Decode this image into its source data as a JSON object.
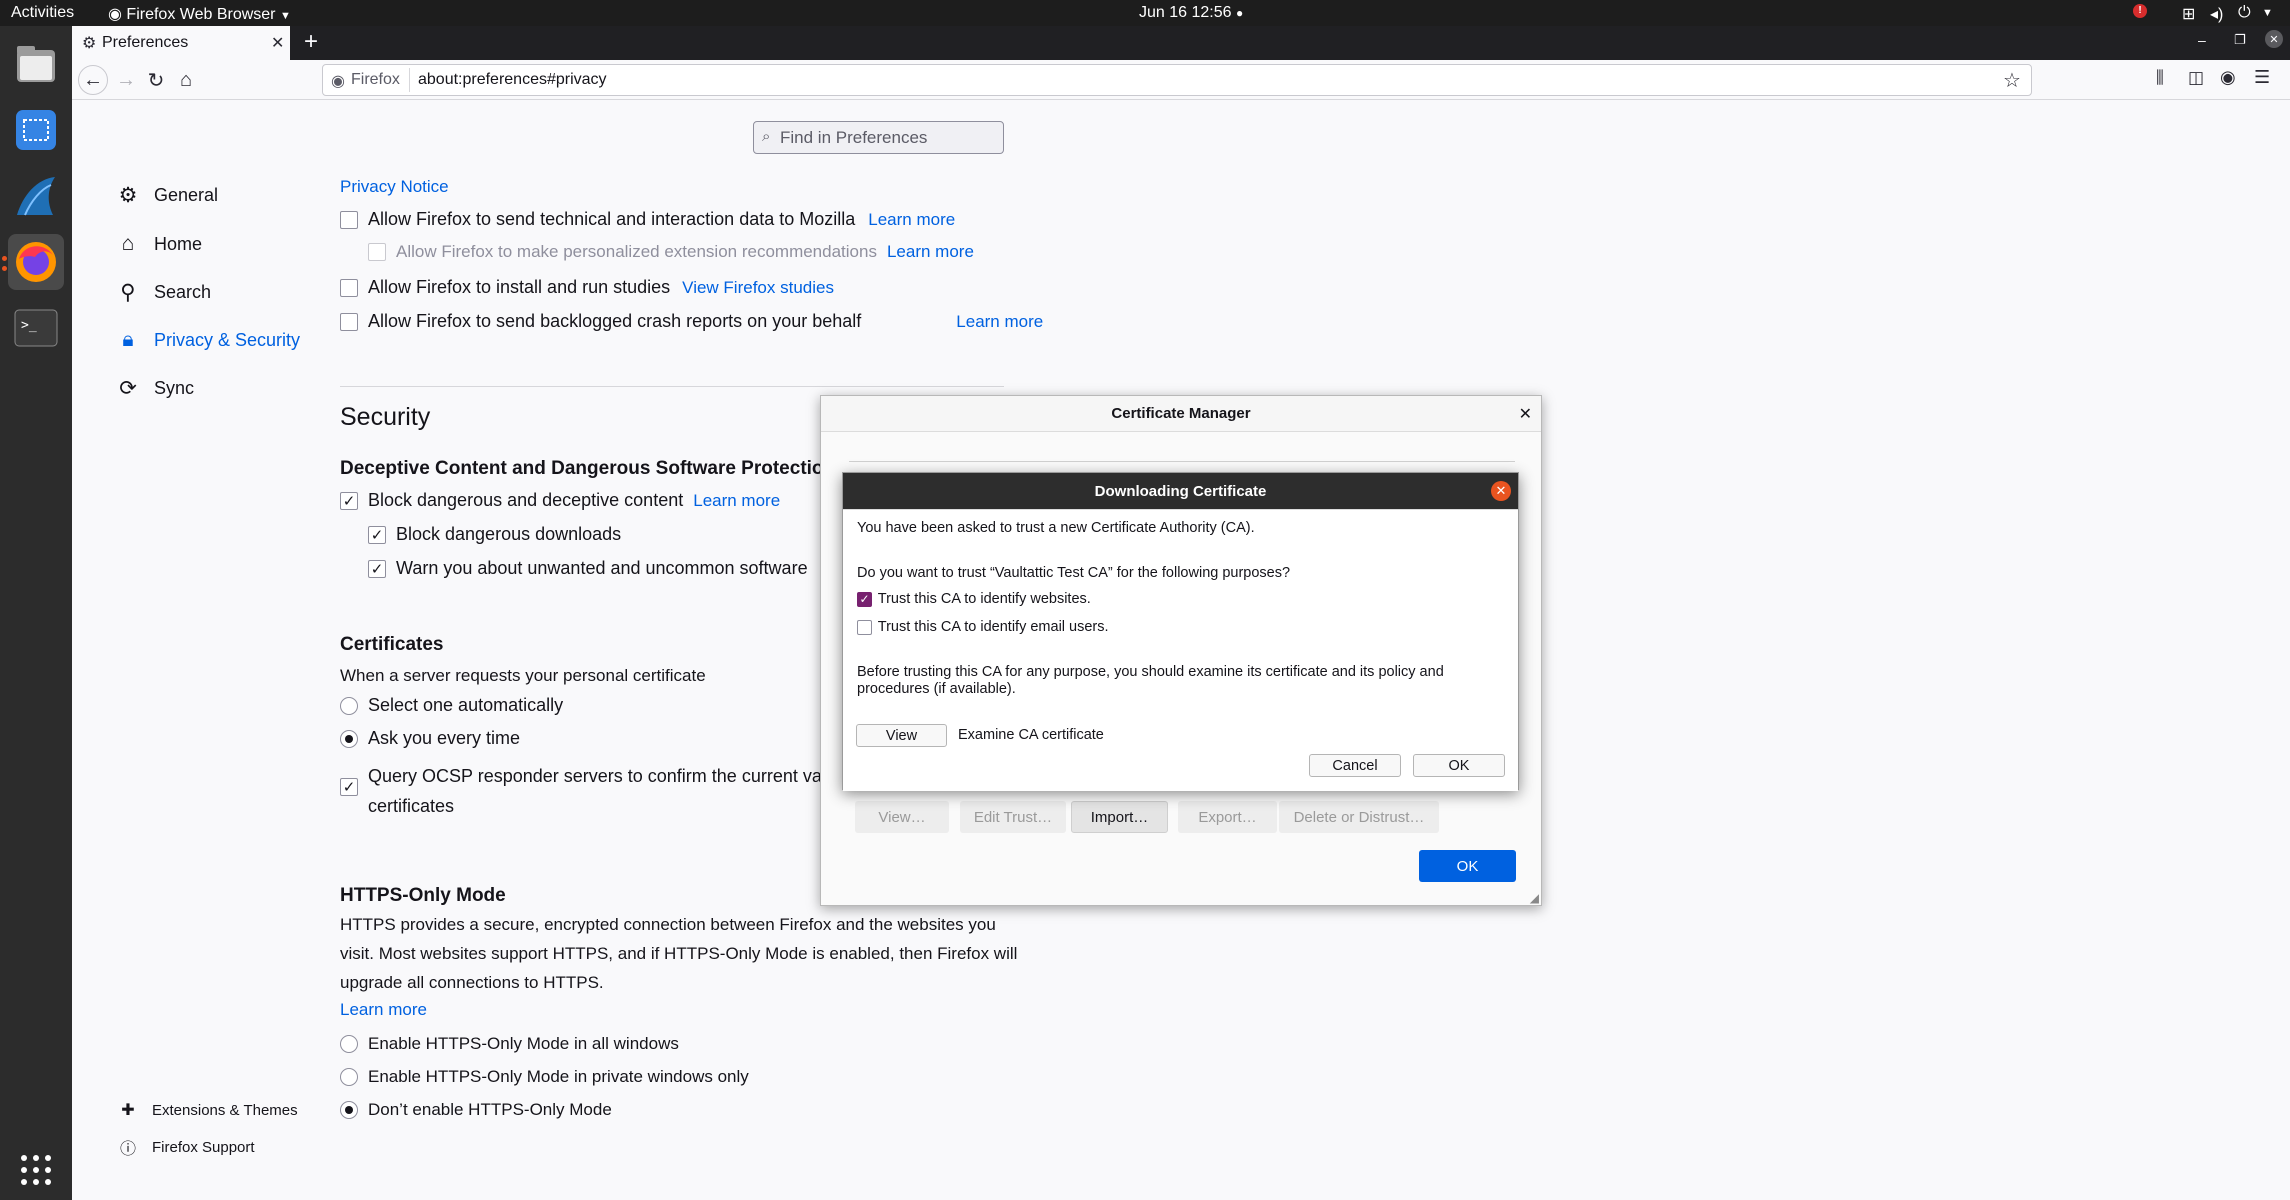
{
  "topbar": {
    "activities": "Activities",
    "app_menu": "Firefox Web Browser",
    "clock": "Jun 16  12:56"
  },
  "dock": {
    "apps": [
      {
        "name": "Files",
        "icon": "file-manager-icon"
      },
      {
        "name": "Screenshot",
        "icon": "screenshot-icon"
      },
      {
        "name": "Wireshark",
        "icon": "wireshark-icon"
      },
      {
        "name": "Firefox",
        "icon": "firefox-icon"
      },
      {
        "name": "Terminal",
        "icon": "terminal-icon"
      }
    ],
    "show_apps_icon": "grid-icon"
  },
  "browser": {
    "tab_title": "Preferences",
    "url_identity": "Firefox",
    "url": "about:preferences#privacy"
  },
  "prefs": {
    "search_placeholder": "Find in Preferences",
    "categories": {
      "general": "General",
      "home": "Home",
      "search": "Search",
      "privacy": "Privacy & Security",
      "sync": "Sync",
      "extensions": "Extensions & Themes",
      "support": "Firefox Support"
    },
    "data_collection": {
      "privacy_notice": "Privacy Notice",
      "telemetry": "Allow Firefox to send technical and interaction data to Mozilla",
      "recommendations": "Allow Firefox to make personalized extension recommendations",
      "studies": "Allow Firefox to install and run studies",
      "view_studies": "View Firefox studies",
      "crash_reports": "Allow Firefox to send backlogged crash reports on your behalf",
      "learn_more": "Learn more"
    },
    "security": {
      "heading": "Security",
      "deceptive_heading": "Deceptive Content and Dangerous Software Protection",
      "block_deceptive": "Block dangerous and deceptive content",
      "block_downloads": "Block dangerous downloads",
      "warn_unwanted": "Warn you about unwanted and uncommon software",
      "learn_more": "Learn more"
    },
    "certificates": {
      "heading": "Certificates",
      "intro": "When a server requests your personal certificate",
      "select_auto": "Select one automatically",
      "ask_every": "Ask you every time",
      "ocsp_line1": "Query OCSP responder servers to confirm the current validity of",
      "ocsp_line2": "certificates"
    },
    "https_only": {
      "heading": "HTTPS-Only Mode",
      "desc_line1": "HTTPS provides a secure, encrypted connection between Firefox and the websites you",
      "desc_line2": "visit. Most websites support HTTPS, and if HTTPS-Only Mode is enabled, then Firefox will",
      "desc_line3": "upgrade all connections to HTTPS.",
      "learn_more": "Learn more",
      "all_windows": "Enable HTTPS-Only Mode in all windows",
      "private_only": "Enable HTTPS-Only Mode in private windows only",
      "dont_enable": "Don’t enable HTTPS-Only Mode"
    }
  },
  "cert_manager": {
    "title": "Certificate Manager",
    "buttons": {
      "view": "View…",
      "edit_trust": "Edit Trust…",
      "import": "Import…",
      "export": "Export…",
      "delete": "Delete or Distrust…",
      "ok": "OK"
    }
  },
  "download_cert": {
    "title": "Downloading Certificate",
    "intro": "You have been asked to trust a new Certificate Authority (CA).",
    "question": "Do you want to trust “Vaultattic Test CA” for the following purposes?",
    "trust_websites": "Trust this CA to identify websites.",
    "trust_email": "Trust this CA to identify email users.",
    "advice_line1": "Before trusting this CA for any purpose, you should examine its certificate and its policy and",
    "advice_line2": "procedures (if available).",
    "view_button": "View",
    "examine_label": "Examine CA certificate",
    "cancel_button": "Cancel",
    "ok_button": "OK"
  },
  "colors": {
    "accent": "#0061e0",
    "ubuntu_orange": "#e95420",
    "checkbox_purple": "#77216f"
  }
}
